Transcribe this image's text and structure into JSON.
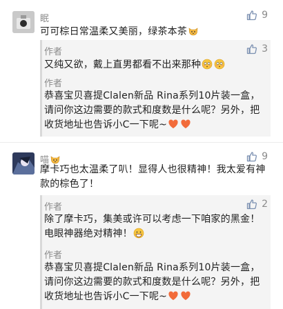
{
  "comments": [
    {
      "nickname": "眠",
      "likes": "9",
      "text": "可可棕日常温柔又美丽，绿茶本茶",
      "replies": [
        {
          "author": "作者",
          "likes": "3",
          "text": "又纯又欲，戴上直男都看不出来那种"
        },
        {
          "author": "作者",
          "likes": "",
          "text": "恭喜宝贝喜提Clalen新品 Rina系列10片装一盒，请问你这边需要的款式和度数是什么呢？另外，把收货地址也告诉小C一下呢~"
        }
      ]
    },
    {
      "nickname": "喵",
      "likes": "9",
      "text": "摩卡巧也太温柔了叭！显得人也很精神！我太爱有神款的棕色了！",
      "replies": [
        {
          "author": "作者",
          "likes": "2",
          "text": "除了摩卡巧，集美或许可以考虑一下咱家的黑金！电眼神器绝对精神！"
        },
        {
          "author": "作者",
          "likes": "",
          "text": "恭喜宝贝喜提Clalen新品 Rina系列10片装一盒，请问你这边需要的款式和度数是什么呢？另外，把收货地址也告诉小C一下呢~"
        }
      ]
    }
  ],
  "icons": {
    "like": "thumbs-up-icon",
    "cat": "cat-emoji-icon",
    "blush": "flushed-face-emoji",
    "heart": "orange-heart-emoji",
    "grin": "grinning-face-emoji"
  },
  "colors": {
    "like_icon": "#7a8fb0",
    "reply_bg": "#f4f4f4",
    "heart": "#f26b3a"
  }
}
